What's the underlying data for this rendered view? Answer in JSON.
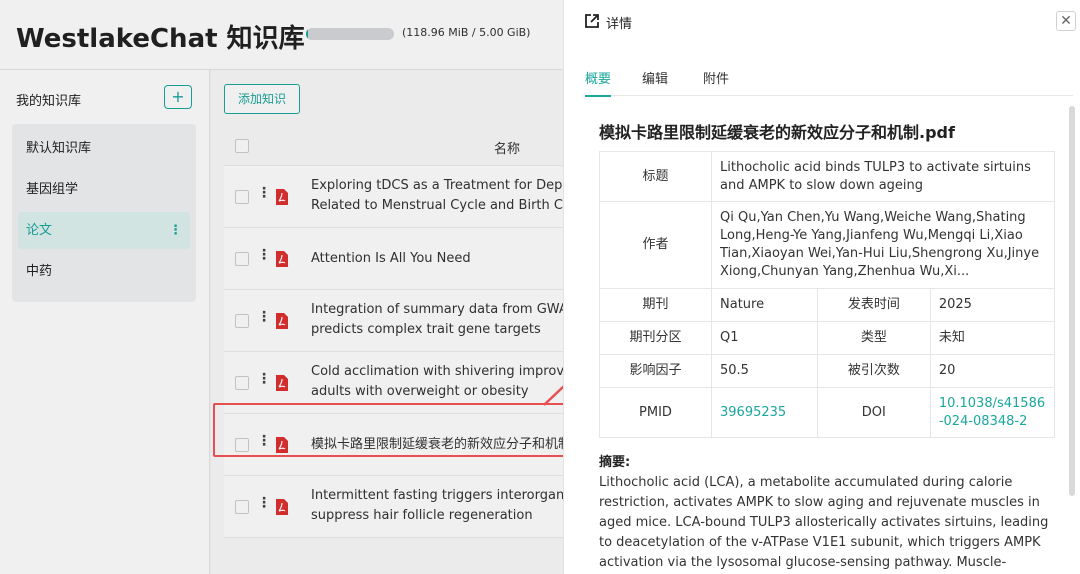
{
  "app": {
    "title": "WestlakeChat 知识库",
    "quota_text": "(118.96 MiB / 5.00 GiB)",
    "quota_fraction": 0.023
  },
  "sidebar": {
    "title": "我的知识库",
    "add_label": "+",
    "items": [
      {
        "label": "默认知识库"
      },
      {
        "label": "基因组学"
      },
      {
        "label": "论文",
        "more": "⋮"
      },
      {
        "label": "中药"
      }
    ]
  },
  "main": {
    "add_button": "添加知识",
    "column_name": "名称",
    "rows": [
      {
        "title": "Exploring tDCS as a Treatment for Depression",
        "title2": "Related to Menstrual Cycle and Birth Control"
      },
      {
        "title": "Attention Is All You Need",
        "title2": ""
      },
      {
        "title": "Integration of summary data from GWAS and eQTL",
        "title2": "predicts complex trait gene targets"
      },
      {
        "title": "Cold acclimation with shivering improves metabolic health in",
        "title2": "adults with overweight or obesity"
      },
      {
        "title": "模拟卡路里限制延缓衰老的新效应分子和机制.pdf",
        "title2": ""
      },
      {
        "title": "Intermittent fasting triggers interorgan communication to",
        "title2": "suppress hair follicle regeneration"
      }
    ]
  },
  "drawer": {
    "title": "详情",
    "close": "✕",
    "tabs": [
      "概要",
      "编辑",
      "附件"
    ],
    "file_title": "模拟卡路里限制延缓衰老的新效应分子和机制.pdf",
    "info": {
      "title_label": "标题",
      "title_value": "Lithocholic acid binds TULP3 to activate sirtuins and AMPK to slow down ageing",
      "author_label": "作者",
      "author_value": "Qi Qu,Yan Chen,Yu Wang,Weiche Wang,Shating Long,Heng-Ye Yang,Jianfeng Wu,Mengqi Li,Xiao Tian,Xiaoyan Wei,Yan-Hui Liu,Shengrong Xu,Jinye Xiong,Chunyan Yang,Zhenhua Wu,Xi...",
      "journal_label": "期刊",
      "journal_value": "Nature",
      "pubtime_label": "发表时间",
      "pubtime_value": "2025",
      "partition_label": "期刊分区",
      "partition_value": "Q1",
      "type_label": "类型",
      "type_value": "未知",
      "if_label": "影响因子",
      "if_value": "50.5",
      "cite_label": "被引次数",
      "cite_value": "20",
      "pmid_label": "PMID",
      "pmid_value": "39695235",
      "doi_label": "DOI",
      "doi_value": "10.1038/s41586-024-08348-2"
    },
    "abstract_title": "摘要:",
    "abstract_text": "Lithocholic acid (LCA), a metabolite accumulated during calorie restriction, activates AMPK to slow aging and rejuvenate muscles in aged mice. LCA-bound TULP3 allosterically activates sirtuins, leading to deacetylation of the v-ATPase V1E1 subunit, which triggers AMPK activation via the lysosomal glucose-sensing pathway. Muscle-specific expression of a deacetylation-"
  },
  "colors": {
    "accent": "#1aa79c",
    "highlight": "#e65050"
  }
}
